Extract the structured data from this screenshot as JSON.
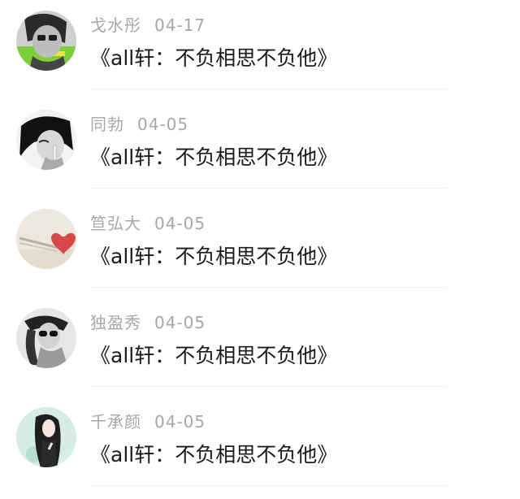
{
  "comments": [
    {
      "user": "戈水彤",
      "date": "04-17",
      "text": "《all轩：不负相思不负他》",
      "avatar": "avatar-boy-glasses-icon"
    },
    {
      "user": "同勃",
      "date": "04-05",
      "text": "《all轩：不负相思不负他》",
      "avatar": "avatar-boy-smoking-icon"
    },
    {
      "user": "笪弘大",
      "date": "04-05",
      "text": "《all轩：不负相思不负他》",
      "avatar": "avatar-heart-icon"
    },
    {
      "user": "独盈秀",
      "date": "04-05",
      "text": "《all轩：不负相思不负他》",
      "avatar": "avatar-girl-sunglasses-icon"
    },
    {
      "user": "千承颜",
      "date": "04-05",
      "text": "《all轩：不负相思不负他》",
      "avatar": "avatar-girl-illustration-icon"
    }
  ]
}
